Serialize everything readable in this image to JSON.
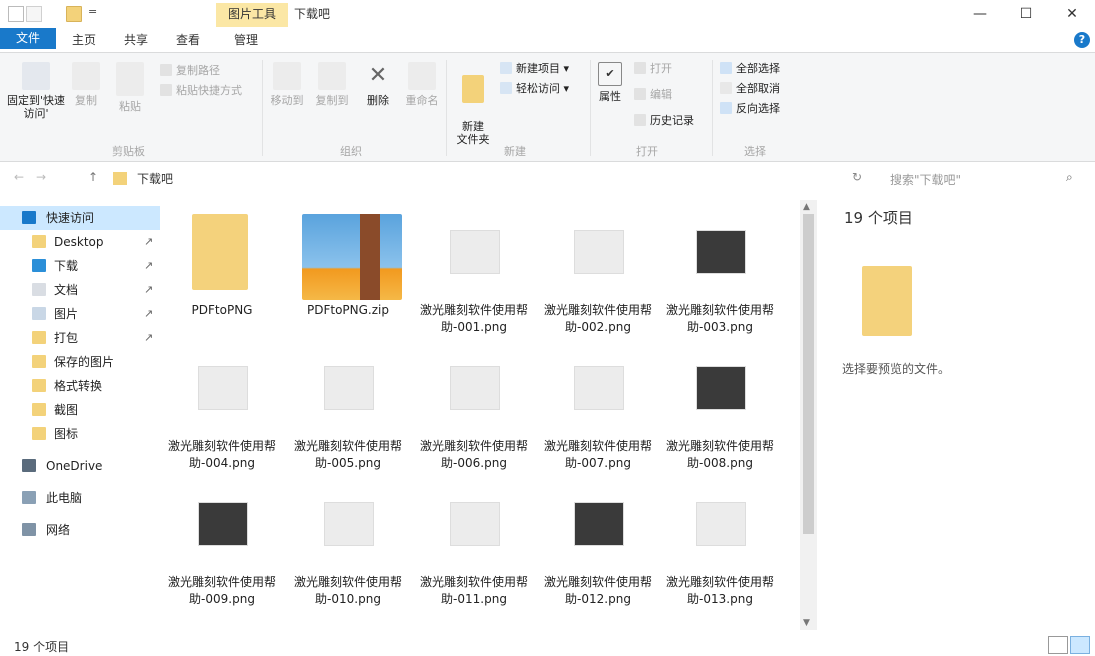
{
  "titlebar": {
    "picture_tools": "图片工具",
    "title": "下载吧",
    "qa_arrow": "=",
    "minimize": "—",
    "maximize": "☐",
    "close": "✕"
  },
  "tabs": {
    "file": "文件",
    "home": "主页",
    "share": "共享",
    "view": "查看",
    "manage": "管理",
    "help": "?"
  },
  "ribbon": {
    "pin": "固定到'快速访问'",
    "copy": "复制",
    "paste": "粘贴",
    "copy_path": "复制路径",
    "paste_shortcut": "粘贴快捷方式",
    "move_to": "移动到",
    "copy_to": "复制到",
    "delete": "删除",
    "rename": "重命名",
    "new_folder": "新建\n文件夹",
    "new_item": "新建项目",
    "easy_access": "轻松访问",
    "properties": "属性",
    "open": "打开",
    "edit": "编辑",
    "history": "历史记录",
    "select_all": "全部选择",
    "select_none": "全部取消",
    "invert": "反向选择",
    "group_clipboard": "剪贴板",
    "group_organize": "组织",
    "group_new": "新建",
    "group_open": "打开",
    "group_select": "选择"
  },
  "address": {
    "back": "←",
    "forward": "→",
    "up": "↑",
    "path": "下载吧",
    "refresh": "↻",
    "search_placeholder": "搜索\"下载吧\"",
    "search_icon": "⌕"
  },
  "navpane": {
    "items": [
      {
        "label": "快速访问",
        "icon": "star-icon",
        "pinned": false
      },
      {
        "label": "Desktop",
        "icon": "folder-icon",
        "pinned": true
      },
      {
        "label": "下载",
        "icon": "download-icon",
        "pinned": true
      },
      {
        "label": "文档",
        "icon": "documents-icon",
        "pinned": true
      },
      {
        "label": "图片",
        "icon": "pictures-icon",
        "pinned": true
      },
      {
        "label": "打包",
        "icon": "folder-icon",
        "pinned": true
      },
      {
        "label": "保存的图片",
        "icon": "folder-icon",
        "pinned": false
      },
      {
        "label": "格式转换",
        "icon": "folder-icon",
        "pinned": false
      },
      {
        "label": "截图",
        "icon": "folder-icon",
        "pinned": false
      },
      {
        "label": "图标",
        "icon": "folder-icon",
        "pinned": false
      },
      {
        "label": "OneDrive",
        "icon": "cloud-icon",
        "pinned": false
      },
      {
        "label": "此电脑",
        "icon": "computer-icon",
        "pinned": false
      },
      {
        "label": "网络",
        "icon": "network-icon",
        "pinned": false
      }
    ],
    "pin_glyph": "↗"
  },
  "files": [
    {
      "name": "PDFtoPNG",
      "type": "folder"
    },
    {
      "name": "PDFtoPNG.zip",
      "type": "zip"
    },
    {
      "name": "激光雕刻软件使用帮助-001.png",
      "type": "image"
    },
    {
      "name": "激光雕刻软件使用帮助-002.png",
      "type": "image"
    },
    {
      "name": "激光雕刻软件使用帮助-003.png",
      "type": "image"
    },
    {
      "name": "激光雕刻软件使用帮助-004.png",
      "type": "image"
    },
    {
      "name": "激光雕刻软件使用帮助-005.png",
      "type": "image"
    },
    {
      "name": "激光雕刻软件使用帮助-006.png",
      "type": "image"
    },
    {
      "name": "激光雕刻软件使用帮助-007.png",
      "type": "image"
    },
    {
      "name": "激光雕刻软件使用帮助-008.png",
      "type": "image"
    },
    {
      "name": "激光雕刻软件使用帮助-009.png",
      "type": "image"
    },
    {
      "name": "激光雕刻软件使用帮助-010.png",
      "type": "image"
    },
    {
      "name": "激光雕刻软件使用帮助-011.png",
      "type": "image"
    },
    {
      "name": "激光雕刻软件使用帮助-012.png",
      "type": "image"
    },
    {
      "name": "激光雕刻软件使用帮助-013.png",
      "type": "image"
    }
  ],
  "details": {
    "count": "19 个项目",
    "label": "选择要预览的文件。"
  },
  "status": {
    "text": "19 个项目"
  },
  "colors": {
    "accent": "#1979ca",
    "selection": "#cce8ff",
    "folder": "#f3d27a"
  }
}
